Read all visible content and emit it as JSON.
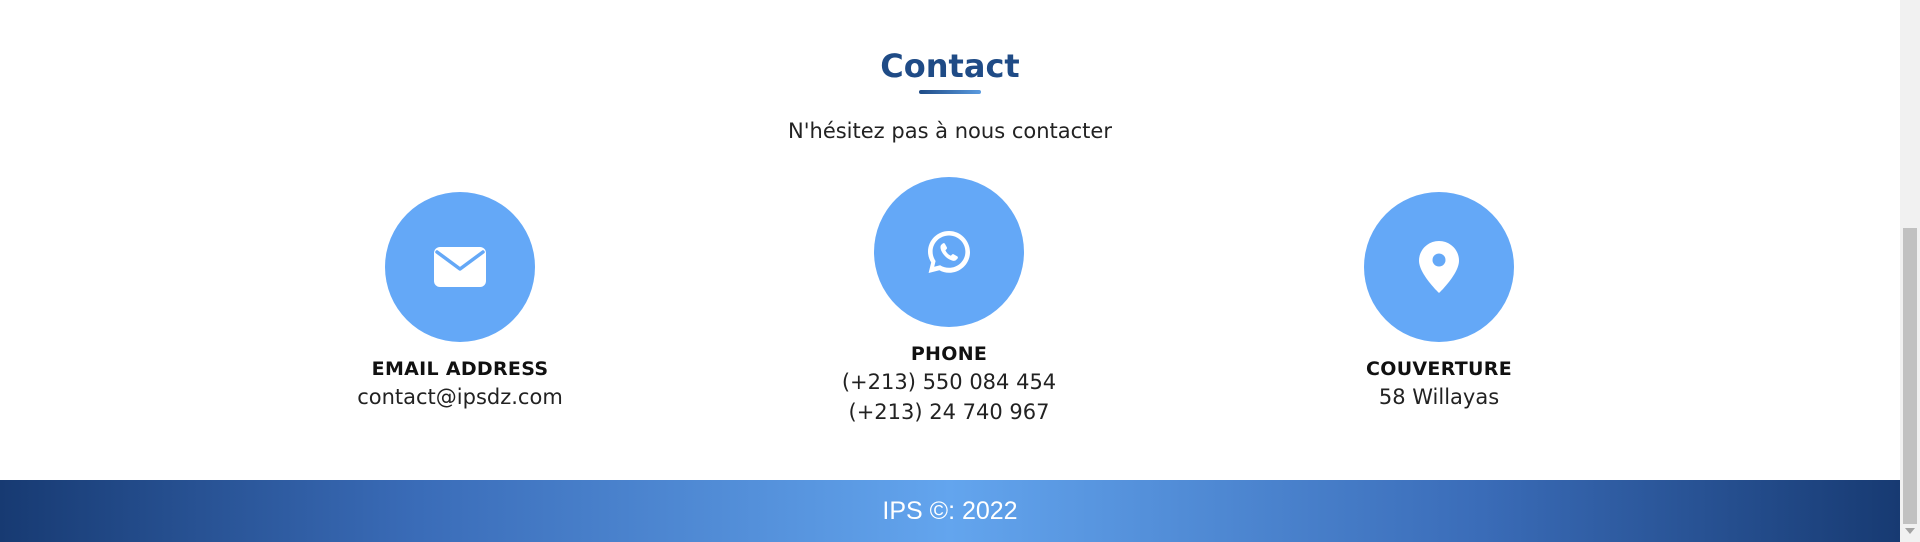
{
  "section": {
    "title": "Contact",
    "subtitle": "N'hésitez pas à nous contacter"
  },
  "cards": [
    {
      "icon": "envelope-icon",
      "title": "EMAIL ADDRESS",
      "lines": [
        "contact@ipsdz.com"
      ]
    },
    {
      "icon": "whatsapp-icon",
      "title": "PHONE",
      "lines": [
        "(+213) 550 084 454",
        "(+213) 24 740 967"
      ]
    },
    {
      "icon": "map-pin-icon",
      "title": "COUVERTURE",
      "lines": [
        "58 Willayas"
      ]
    }
  ],
  "footer": {
    "text": "IPS ©: 2022"
  },
  "colors": {
    "title": "#1f4b86",
    "icon_circle": "#64a8f7",
    "footer_dark": "#173a72",
    "footer_light": "#63a5ee"
  }
}
